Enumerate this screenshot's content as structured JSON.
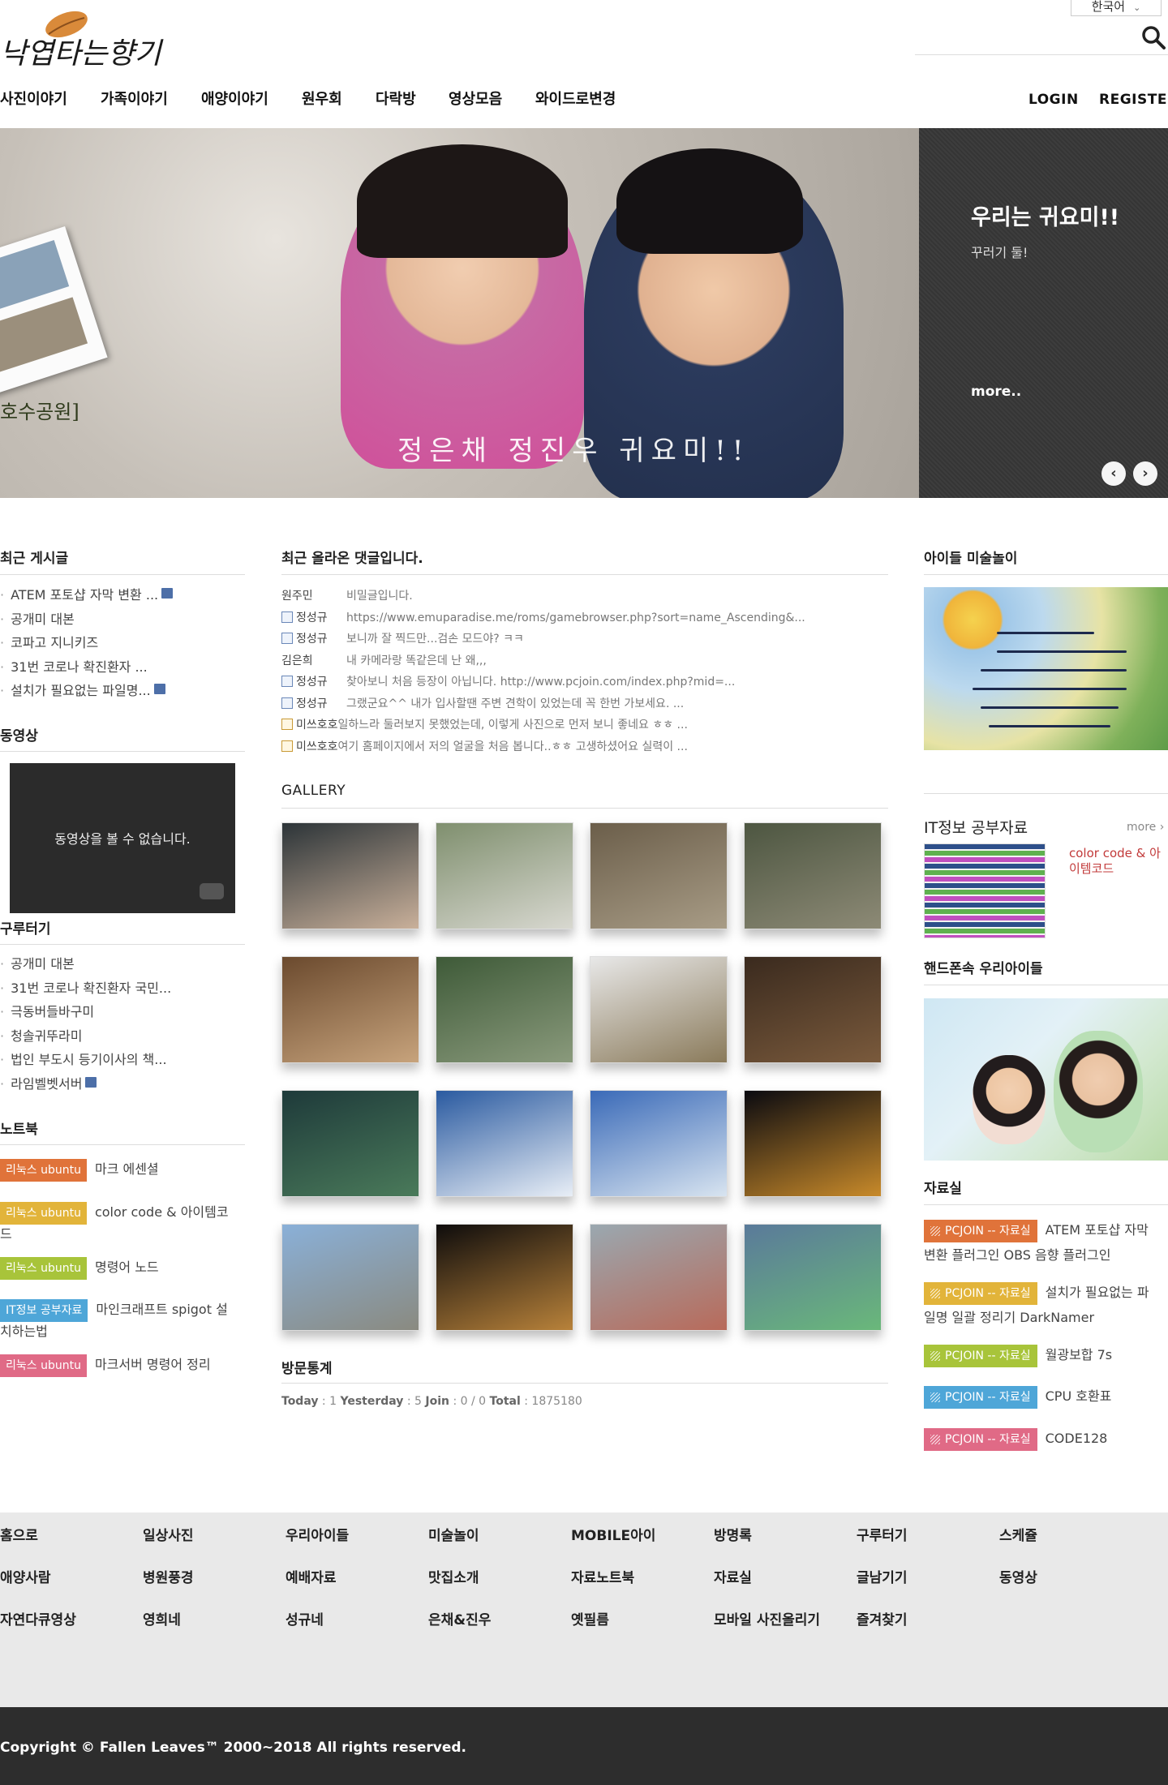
{
  "header": {
    "logo_text": "낙엽타는향기",
    "language": "한국어",
    "nav": [
      "사진이야기",
      "가족이야기",
      "애양이야기",
      "원우회",
      "다락방",
      "영상모음",
      "와이드로변경"
    ],
    "login": "LOGIN",
    "register": "REGISTER"
  },
  "slider": {
    "photo_caption": "정은채 정진우 귀요미!!",
    "side_caption": "호수공원]",
    "title": "우리는 귀요미!!",
    "subtitle": "꾸러기 둘!",
    "more": "more..",
    "prev": "‹",
    "next": "›"
  },
  "recent_posts": {
    "title": "최근 게시글",
    "items": [
      "ATEM 포토샵 자막 변환 ...",
      "공개미 대본",
      "코파고 지니키즈",
      "31번 코로나 확진환자 ...",
      "설치가 필요없는 파일명..."
    ]
  },
  "video": {
    "title": "동영상",
    "message": "동영상을 볼 수 없습니다."
  },
  "gurutugi": {
    "title": "구루터기",
    "items": [
      "공개미 대본",
      "31번 코로나 확진환자 국민...",
      "극동버들바구미",
      "청솔귀뚜라미",
      "법인 부도시 등기이사의 책...",
      "라임벨벳서버"
    ]
  },
  "notebook": {
    "title": "노트북",
    "items": [
      {
        "tag": "리눅스 ubuntu",
        "color": "#e0733a",
        "text": "마크 에센셜",
        "text2": ""
      },
      {
        "tag": "리눅스 ubuntu",
        "color": "#e2b43a",
        "text": "color code & 아이템코",
        "text2": "드"
      },
      {
        "tag": "리눅스 ubuntu",
        "color": "#a8c43a",
        "text": "명령어 노드",
        "text2": ""
      },
      {
        "tag": "IT정보 공부자료",
        "color": "#4ea6d8",
        "text": "마인크래프트 spigot 설",
        "text2": "치하는법"
      },
      {
        "tag": "리눅스 ubuntu",
        "color": "#e06a86",
        "text": "마크서버 명령어 정리",
        "text2": ""
      }
    ]
  },
  "comments": {
    "title": "최근 올라온 댓글입니다.",
    "items": [
      {
        "who": "원주민",
        "icon": "",
        "text": "비밀글입니다."
      },
      {
        "who": "정성규",
        "icon": "profile",
        "text": "https://www.emuparadise.me/roms/gamebrowser.php?sort=name_Ascending&..."
      },
      {
        "who": "정성규",
        "icon": "profile",
        "text": "보니까 잘 찍드만...검손 모드야? ㅋㅋ"
      },
      {
        "who": "김은희",
        "icon": "",
        "text": "내 카메라랑 똑같은데 난 왜,,,"
      },
      {
        "who": "정성규",
        "icon": "profile",
        "text": "찾아보니 처음 등장이 아닙니다. http://www.pcjoin.com/index.php?mid=..."
      },
      {
        "who": "정성규",
        "icon": "profile",
        "text": "그랬군요^^ 내가 입사할땐 주변 견학이 있었는데 꼭 한번 가보세요. ..."
      },
      {
        "who": "미쓰호호",
        "icon": "user",
        "text": "일하느라 둘러보지 못했었는데, 이렇게 사진으로 먼저 보니 좋네요 ㅎㅎ ..."
      },
      {
        "who": "미쓰호호",
        "icon": "user",
        "text": "여기 홈페이지에서 저의 얼굴을 처음 봅니다..ㅎㅎ 고생하셨어요 실력이 ..."
      }
    ]
  },
  "gallery": {
    "title": "GALLERY",
    "thumbs": [
      {
        "c1": "#2c3438",
        "c2": "#c9b09a"
      },
      {
        "c1": "#7f8f6e",
        "c2": "#d8d8d0"
      },
      {
        "c1": "#6b5e4a",
        "c2": "#a89c86"
      },
      {
        "c1": "#4d5641",
        "c2": "#8d8a76"
      },
      {
        "c1": "#6b4a2e",
        "c2": "#c7a37c"
      },
      {
        "c1": "#3e5a38",
        "c2": "#8a9a7c"
      },
      {
        "c1": "#e8e8e8",
        "c2": "#8a7a5a"
      },
      {
        "c1": "#3a2a1e",
        "c2": "#7a5a3c"
      },
      {
        "c1": "#1e3a3a",
        "c2": "#4a7a5a"
      },
      {
        "c1": "#2a5aa0",
        "c2": "#e8eef6"
      },
      {
        "c1": "#3a6ab8",
        "c2": "#d8e4f0"
      },
      {
        "c1": "#0a0a10",
        "c2": "#c88a2a"
      },
      {
        "c1": "#8ab0d8",
        "c2": "#8a8a80"
      },
      {
        "c1": "#0e0c0c",
        "c2": "#b8823a"
      },
      {
        "c1": "#9aa8b0",
        "c2": "#b86a5a"
      },
      {
        "c1": "#5a7a9a",
        "c2": "#6ab87a"
      }
    ]
  },
  "stats": {
    "title": "방문통계",
    "today_label": "Today",
    "today": "1",
    "yesterday_label": "Yesterday",
    "yesterday": "5",
    "join_label": "Join",
    "join": "0 / 0",
    "total_label": "Total",
    "total": "1875180"
  },
  "right": {
    "art_title": "아이들 미술놀이",
    "it_title": "IT정보 공부자료",
    "it_more": "more",
    "it_text": "color code & 아이템코드",
    "family_title": "핸드폰속 우리아이들",
    "pds_title": "자료실",
    "pds": [
      {
        "tag": "PCJOIN -- 자료실",
        "color": "#e0733a",
        "text": "ATEM 포토샵 자막",
        "text2": "변환 플러그인 OBS 음향 플러그인"
      },
      {
        "tag": "PCJOIN -- 자료실",
        "color": "#e2b43a",
        "text": "설치가 필요없는 파",
        "text2": "일명 일괄 정리기 DarkNamer"
      },
      {
        "tag": "PCJOIN -- 자료실",
        "color": "#a8c43a",
        "text": "월광보합 7s",
        "text2": ""
      },
      {
        "tag": "PCJOIN -- 자료실",
        "color": "#4ea6d8",
        "text": "CPU 호환표",
        "text2": ""
      },
      {
        "tag": "PCJOIN -- 자료실",
        "color": "#e06a86",
        "text": "CODE128",
        "text2": ""
      }
    ]
  },
  "footer": {
    "menu": [
      [
        "홈으로",
        "일상사진",
        "우리아이들",
        "미술놀이",
        "MOBILE아이",
        "방명록",
        "구루터기",
        "스케쥴"
      ],
      [
        "애양사람",
        "병원풍경",
        "예배자료",
        "맛집소개",
        "자료노트북",
        "자료실",
        "글남기기",
        "동영상"
      ],
      [
        "자연다큐영상",
        "영희네",
        "성규네",
        "은채&진우",
        "옛필름",
        "모바일 사진올리기",
        "즐겨찾기",
        ""
      ]
    ],
    "copyright": "Copyright © Fallen Leaves™ 2000~2018 All rights reserved."
  }
}
